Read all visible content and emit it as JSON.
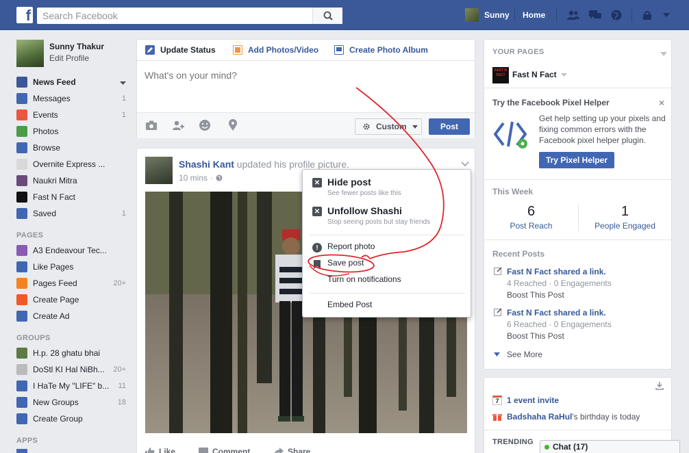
{
  "topbar": {
    "logo": "f",
    "search_placeholder": "Search Facebook",
    "user_name": "Sunny",
    "home_label": "Home"
  },
  "left": {
    "profile_name": "Sunny Thakur",
    "edit_profile": "Edit Profile",
    "nav": [
      {
        "label": "News Feed",
        "count": "",
        "icon": "news-feed-icon",
        "color": "#3b5998"
      },
      {
        "label": "Messages",
        "count": "1",
        "icon": "messages-icon",
        "color": "#4267b2"
      },
      {
        "label": "Events",
        "count": "1",
        "icon": "events-icon",
        "color": "#e9573f"
      },
      {
        "label": "Photos",
        "count": "",
        "icon": "photos-icon",
        "color": "#4c9c4a"
      },
      {
        "label": "Browse",
        "count": "",
        "icon": "browse-icon",
        "color": "#4267b2"
      },
      {
        "label": "Overnite Express ...",
        "count": "",
        "icon": "overnite-icon",
        "color": "#d9d9d9"
      },
      {
        "label": "Naukri Mitra",
        "count": "",
        "icon": "naukri-icon",
        "color": "#6a4b7a"
      },
      {
        "label": "Fast N Fact",
        "count": "",
        "icon": "fastnfact-icon",
        "color": "#111111"
      },
      {
        "label": "Saved",
        "count": "1",
        "icon": "saved-icon",
        "color": "#4267b2"
      }
    ],
    "pages_title": "PAGES",
    "pages": [
      {
        "label": "A3 Endeavour Tec...",
        "count": "",
        "icon": "a3-icon",
        "color": "#8a5bb5"
      },
      {
        "label": "Like Pages",
        "count": "",
        "icon": "like-pages-icon",
        "color": "#4267b2"
      },
      {
        "label": "Pages Feed",
        "count": "20+",
        "icon": "pages-feed-icon",
        "color": "#f58220"
      },
      {
        "label": "Create Page",
        "count": "",
        "icon": "create-page-icon",
        "color": "#f05a28"
      },
      {
        "label": "Create Ad",
        "count": "",
        "icon": "create-ad-icon",
        "color": "#4267b2"
      }
    ],
    "groups_title": "GROUPS",
    "groups": [
      {
        "label": "H.p. 28 ghatu bhai",
        "count": "",
        "icon": "group-hp-icon",
        "color": "#5d7a45"
      },
      {
        "label": "DoStl KI Hal NiBh...",
        "count": "20+",
        "icon": "group-dosti-icon",
        "color": "#bbbbbb"
      },
      {
        "label": "I HaTe My \"LIFE\" b...",
        "count": "11",
        "icon": "group-ihate-icon",
        "color": "#4267b2"
      },
      {
        "label": "New Groups",
        "count": "18",
        "icon": "new-groups-icon",
        "color": "#4267b2"
      },
      {
        "label": "Create Group",
        "count": "",
        "icon": "create-group-icon",
        "color": "#4267b2"
      }
    ],
    "apps_title": "APPS"
  },
  "composer": {
    "tab_status": "Update Status",
    "tab_photos": "Add Photos/Video",
    "tab_album": "Create Photo Album",
    "placeholder": "What's on your mind?",
    "privacy": "Custom",
    "post": "Post"
  },
  "post": {
    "author": "Shashi Kant",
    "action": "updated his profile picture.",
    "time": "10 mins",
    "like": "Like",
    "comment": "Comment",
    "share": "Share"
  },
  "menu": {
    "hide_title": "Hide post",
    "hide_sub": "See fewer posts like this",
    "unfollow_title": "Unfollow Shashi",
    "unfollow_sub": "Stop seeing posts but stay friends",
    "report": "Report photo",
    "save": "Save post",
    "notify": "Turn on notifications",
    "embed": "Embed Post"
  },
  "right": {
    "your_pages": "YOUR PAGES",
    "page_name": "Fast N Fact",
    "page_logo_text": "FAST N FACT",
    "pixel_title": "Try the Facebook Pixel Helper",
    "pixel_body": "Get help setting up your pixels and fixing common errors with the Facebook pixel helper plugin.",
    "pixel_button": "Try Pixel Helper",
    "this_week": "This Week",
    "reach_value": "6",
    "reach_label": "Post Reach",
    "engaged_value": "1",
    "engaged_label": "People Engaged",
    "recent_posts": "Recent Posts",
    "posts": [
      {
        "title": "Fast N Fact shared a link.",
        "meta": "4 Reached · 0 Engagements",
        "boost": "Boost This Post"
      },
      {
        "title": "Fast N Fact shared a link.",
        "meta": "6 Reached · 0 Engagements",
        "boost": "Boost This Post"
      }
    ],
    "see_more": "See More",
    "event_invite": "1 event invite",
    "birthday_name": "Badshaha RaHul",
    "birthday_rest": "'s birthday is today",
    "trending": "TRENDING",
    "chat": "Chat (17)"
  }
}
